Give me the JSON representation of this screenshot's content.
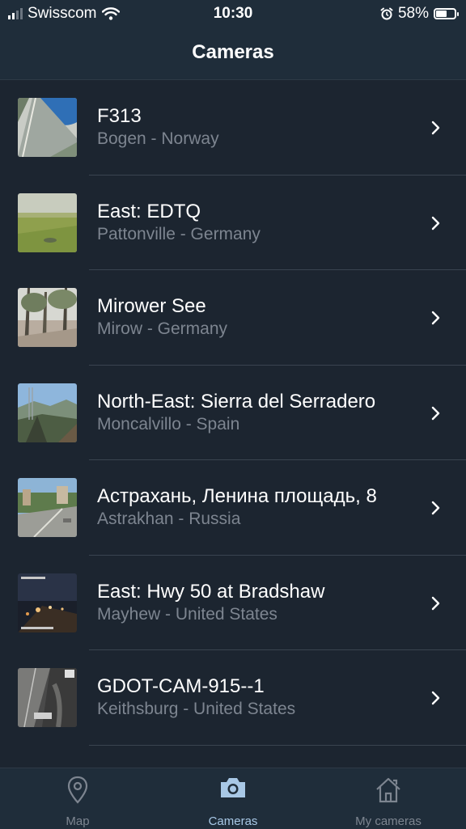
{
  "status": {
    "carrier": "Swisscom",
    "time": "10:30",
    "battery": "58%",
    "battery_level": 0.58
  },
  "nav": {
    "title": "Cameras"
  },
  "cameras": [
    {
      "title": "F313",
      "subtitle": "Bogen - Norway",
      "thumb": "road-water"
    },
    {
      "title": "East: EDTQ",
      "subtitle": "Pattonville - Germany",
      "thumb": "green-field"
    },
    {
      "title": "Mirower See",
      "subtitle": "Mirow - Germany",
      "thumb": "forest"
    },
    {
      "title": "North-East: Sierra del Serradero",
      "subtitle": "Moncalvillo - Spain",
      "thumb": "mountain"
    },
    {
      "title": "Астрахань, Ленина площадь, 8",
      "subtitle": "Astrakhan - Russia",
      "thumb": "city"
    },
    {
      "title": "East: Hwy 50 at Bradshaw",
      "subtitle": "Mayhew - United States",
      "thumb": "night"
    },
    {
      "title": "GDOT-CAM-915--1",
      "subtitle": "Keithsburg - United States",
      "thumb": "highway-bw"
    }
  ],
  "tabs": [
    {
      "label": "Map",
      "icon": "map-pin-icon",
      "active": false
    },
    {
      "label": "Cameras",
      "icon": "camera-icon",
      "active": true
    },
    {
      "label": "My cameras",
      "icon": "home-icon",
      "active": false
    }
  ],
  "colors": {
    "background": "#1c2530",
    "bar": "#1f2d3a",
    "active_tab": "#a8c8e6",
    "inactive": "#7d8590"
  }
}
